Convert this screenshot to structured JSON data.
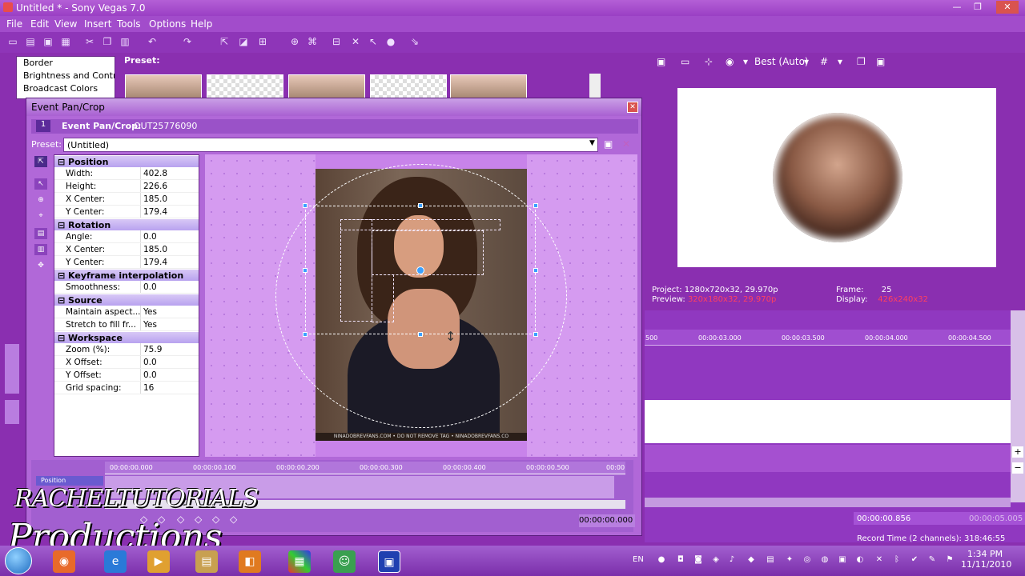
{
  "window": {
    "title": "Untitled * - Sony Vegas 7.0",
    "min": "—",
    "max": "❐",
    "close": "✕"
  },
  "menu": [
    "File",
    "Edit",
    "View",
    "Insert",
    "Tools",
    "Options",
    "Help"
  ],
  "fx_list": [
    "Border",
    "Brightness and Contrast",
    "Broadcast Colors"
  ],
  "preset_label": "Preset:",
  "preview": {
    "quality": "Best (Auto)",
    "project_label": "Project:",
    "project_value": "1280x720x32, 29.970p",
    "preview_label": "Preview:",
    "preview_value": "320x180x32, 29.970p",
    "frame_label": "Frame:",
    "frame_value": "25",
    "display_label": "Display:",
    "display_value": "426x240x32"
  },
  "timeline_ticks": [
    "500",
    "00:00:03.000",
    "00:00:03.500",
    "00:00:04.000",
    "00:00:04.500"
  ],
  "dialog": {
    "title": "Event Pan/Crop",
    "header_number": "1",
    "header_label": "Event Pan/Crop:",
    "header_id": "OUT25776090",
    "preset_label": "Preset:",
    "preset_value": "(Untitled)",
    "sections": [
      {
        "name": "Position",
        "rows": [
          [
            "Width:",
            "402.8"
          ],
          [
            "Height:",
            "226.6"
          ],
          [
            "X Center:",
            "185.0"
          ],
          [
            "Y Center:",
            "179.4"
          ]
        ]
      },
      {
        "name": "Rotation",
        "rows": [
          [
            "Angle:",
            "0.0"
          ],
          [
            "X Center:",
            "185.0"
          ],
          [
            "Y Center:",
            "179.4"
          ]
        ]
      },
      {
        "name": "Keyframe interpolation",
        "rows": [
          [
            "Smoothness:",
            "0.0"
          ]
        ]
      },
      {
        "name": "Source",
        "rows": [
          [
            "Maintain aspect...",
            "Yes"
          ],
          [
            "Stretch to fill fr...",
            "Yes"
          ]
        ]
      },
      {
        "name": "Workspace",
        "rows": [
          [
            "Zoom (%):",
            "75.9"
          ],
          [
            "X Offset:",
            "0.0"
          ],
          [
            "Y Offset:",
            "0.0"
          ],
          [
            "Grid spacing:",
            "16"
          ]
        ]
      }
    ],
    "watermark": "NINADOBREVFANS.COM • DO NOT REMOVE TAG • NINADOBREVFANS.CO",
    "kf_ticks": [
      "00:00:00.000",
      "00:00:00.100",
      "00:00:00.200",
      "00:00:00.300",
      "00:00:00.400",
      "00:00:00.500",
      "00:00"
    ],
    "track_label": "Position",
    "kf_time": "00:00:00.000"
  },
  "branding": {
    "line1": "RACHELTUTORIALS",
    "line2": "Productions"
  },
  "status": {
    "time1": "00:00:00.856",
    "time2": "00:00:05.005",
    "record_time": "Record Time (2 channels): 318:46:55"
  },
  "taskbar": {
    "lang": "EN",
    "time": "1:34 PM",
    "date": "11/11/2010"
  },
  "colors": {
    "accent": "#8a2fb0",
    "selection_handle": "#3aa0ff"
  }
}
